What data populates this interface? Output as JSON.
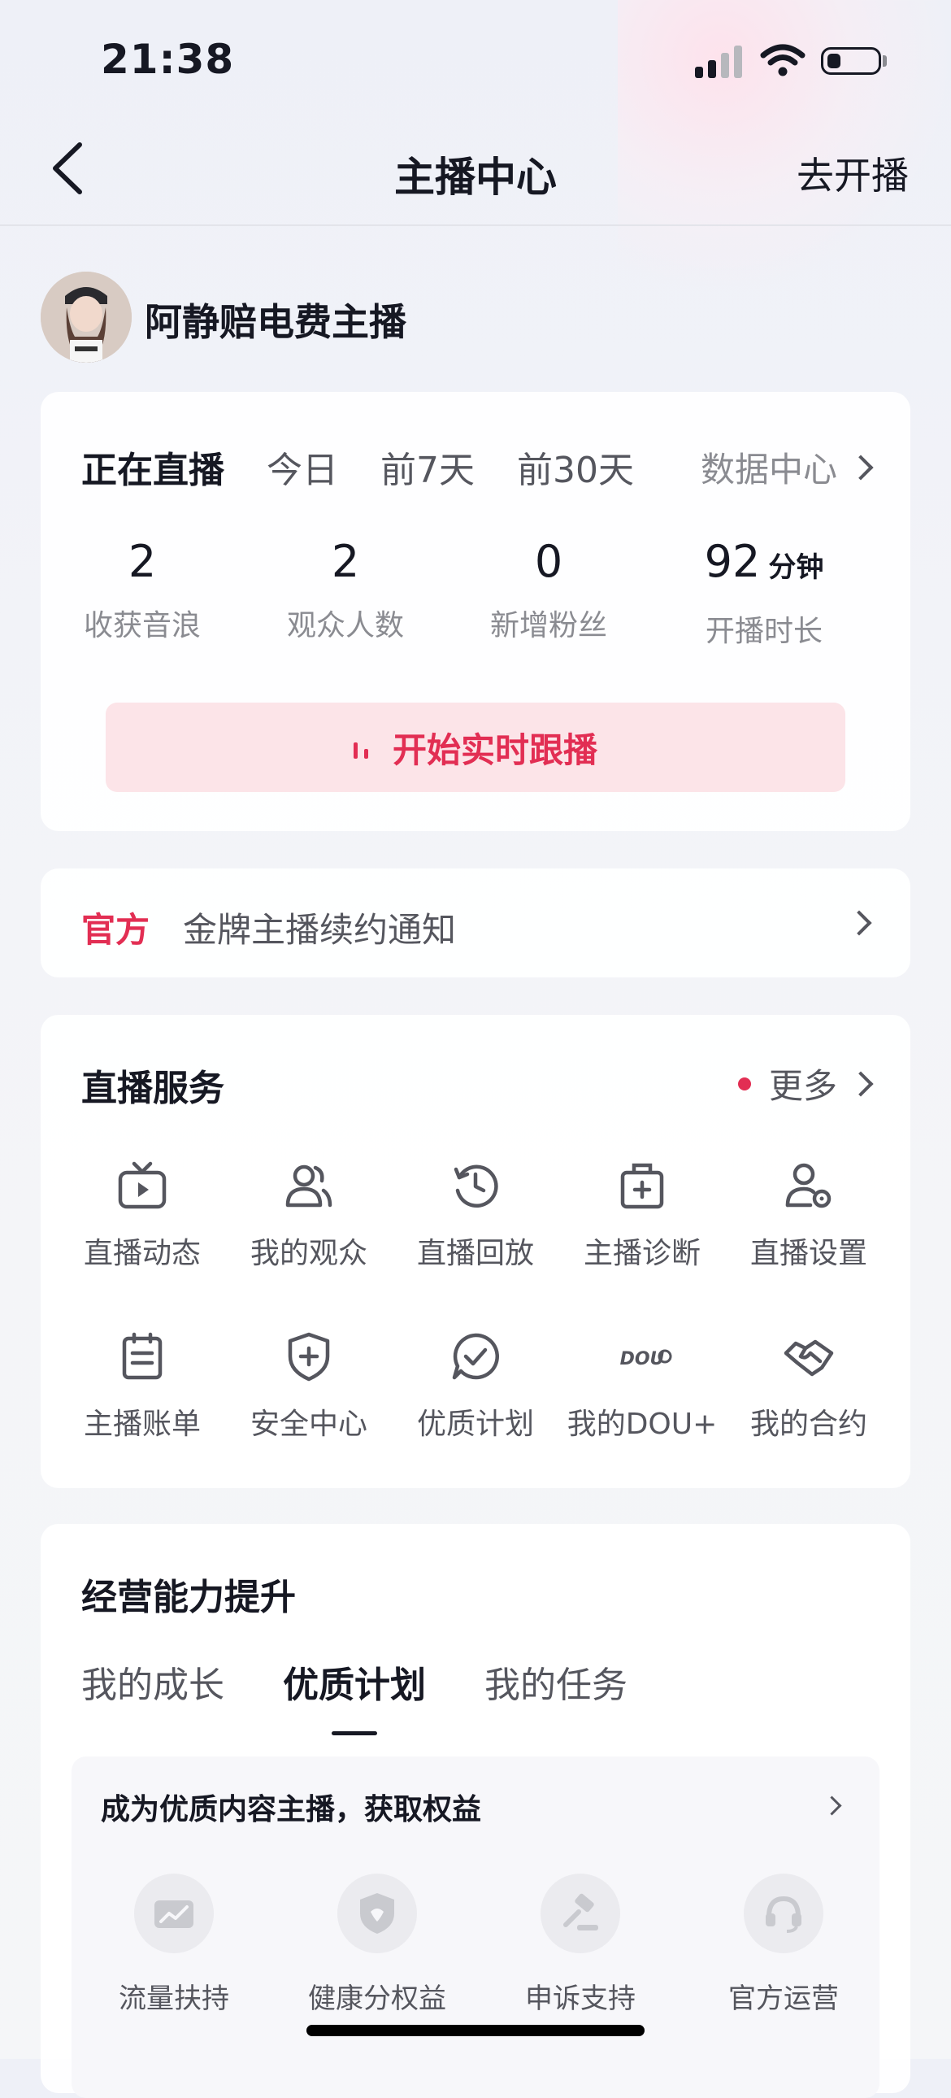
{
  "status_bar": {
    "time": "21:38"
  },
  "nav": {
    "title": "主播中心",
    "right_action": "去开播"
  },
  "profile": {
    "name": "阿静赔电费主播"
  },
  "live_stats": {
    "tabs": [
      "正在直播",
      "今日",
      "前7天",
      "前30天"
    ],
    "active_tab": "正在直播",
    "data_center": "数据中心",
    "stats": [
      {
        "value": "2",
        "unit": "",
        "label": "收获音浪"
      },
      {
        "value": "2",
        "unit": "",
        "label": "观众人数"
      },
      {
        "value": "0",
        "unit": "",
        "label": "新增粉丝"
      },
      {
        "value": "92",
        "unit": "分钟",
        "label": "开播时长"
      }
    ],
    "live_button": "开始实时跟播"
  },
  "notice": {
    "tag": "官方",
    "text": "金牌主播续约通知"
  },
  "services": {
    "title": "直播服务",
    "more": "更多",
    "items": [
      {
        "label": "直播动态",
        "icon": "tv-icon"
      },
      {
        "label": "我的观众",
        "icon": "audience-icon"
      },
      {
        "label": "直播回放",
        "icon": "replay-icon"
      },
      {
        "label": "主播诊断",
        "icon": "medical-kit-icon"
      },
      {
        "label": "直播设置",
        "icon": "user-settings-icon"
      },
      {
        "label": "主播账单",
        "icon": "bill-icon"
      },
      {
        "label": "安全中心",
        "icon": "shield-plus-icon"
      },
      {
        "label": "优质计划",
        "icon": "check-bubble-icon"
      },
      {
        "label": "我的DOU+",
        "icon": "dou-plus-icon"
      },
      {
        "label": "我的合约",
        "icon": "handshake-icon"
      }
    ]
  },
  "growth": {
    "title": "经营能力提升",
    "tabs": [
      "我的成长",
      "优质计划",
      "我的任务"
    ],
    "active_tab": "优质计划",
    "card_title": "成为优质内容主播，获取权益",
    "benefits": [
      {
        "label": "流量扶持",
        "icon": "traffic-chart-icon"
      },
      {
        "label": "健康分权益",
        "icon": "shield-icon"
      },
      {
        "label": "申诉支持",
        "icon": "gavel-icon"
      },
      {
        "label": "官方运营",
        "icon": "headset-icon"
      }
    ]
  },
  "colors": {
    "accent": "#E22E53",
    "accent_bg": "#FCE4E8",
    "text": "#161823",
    "muted": "#8A8B91"
  }
}
